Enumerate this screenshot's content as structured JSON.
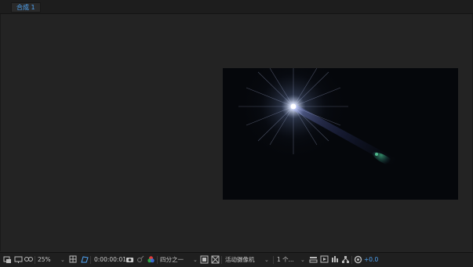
{
  "tab": {
    "label": "合成 1"
  },
  "toolbar": {
    "zoom": "25%",
    "timecode": "0:00:00:01",
    "resolution": "四分之一",
    "camera": "活动摄像机",
    "views": "1 个...",
    "exposure": "+0.0"
  },
  "colors": {
    "accent": "#4fa4f5",
    "panel": "#232323",
    "comp_bg": "#05070b"
  }
}
